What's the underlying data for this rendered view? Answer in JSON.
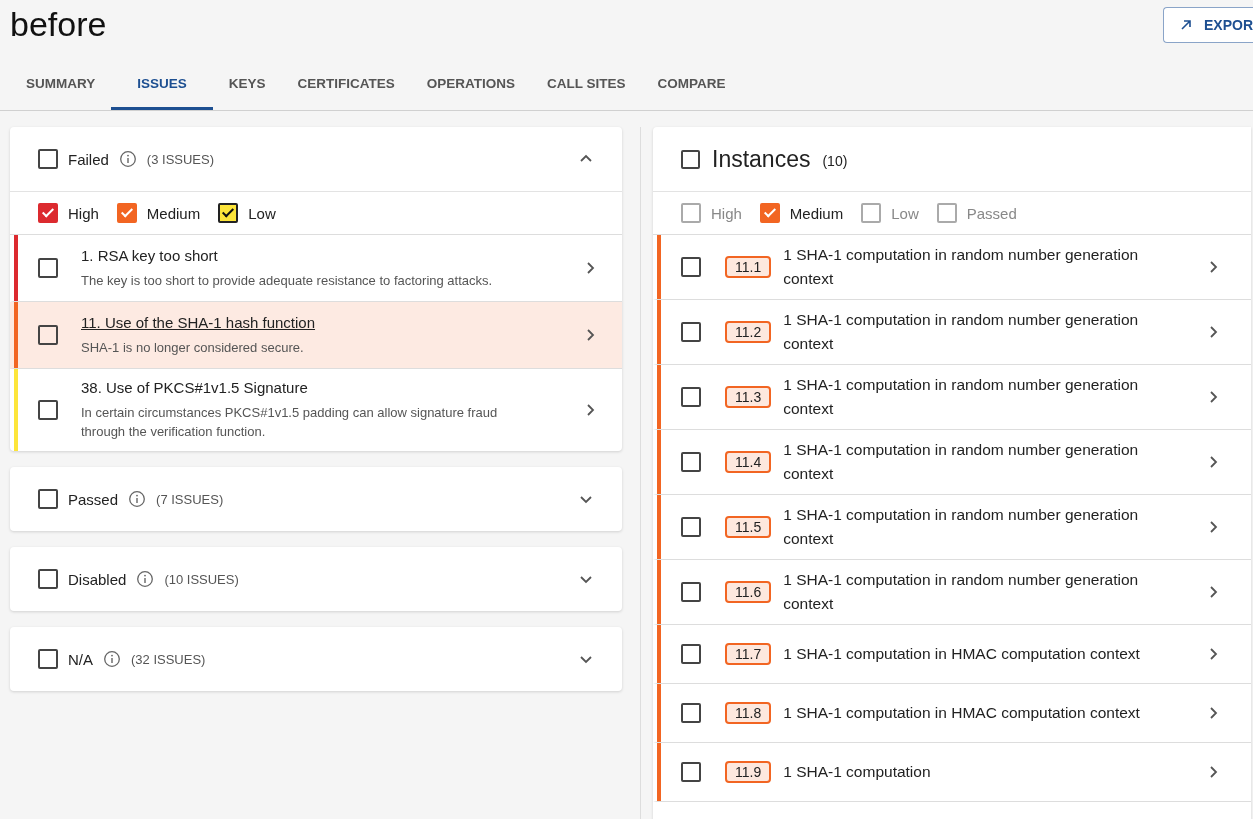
{
  "title": "before",
  "export_button": {
    "label": "EXPOR"
  },
  "tabs": [
    {
      "label": "SUMMARY",
      "selected": false
    },
    {
      "label": "ISSUES",
      "selected": true
    },
    {
      "label": "KEYS",
      "selected": false
    },
    {
      "label": "CERTIFICATES",
      "selected": false
    },
    {
      "label": "OPERATIONS",
      "selected": false
    },
    {
      "label": "CALL SITES",
      "selected": false
    },
    {
      "label": "COMPARE",
      "selected": false
    }
  ],
  "groups": [
    {
      "label": "Failed",
      "count": "(3 ISSUES)",
      "checked": false,
      "expanded": true,
      "filters": [
        {
          "label": "High",
          "checked": true,
          "color": "#dc2a2f"
        },
        {
          "label": "Medium",
          "checked": true,
          "color": "#f26522"
        },
        {
          "label": "Low",
          "checked": true,
          "color": "#fde53a"
        }
      ],
      "issues": [
        {
          "title": "1. RSA key too short",
          "description": "The key is too short to provide adequate resistance to factoring attacks.",
          "checked": false,
          "selected": false,
          "color": "#dc2a2f"
        },
        {
          "title": "11. Use of the SHA-1 hash function",
          "description": "SHA-1 is no longer considered secure.",
          "checked": false,
          "selected": true,
          "color": "#f26522"
        },
        {
          "title": "38. Use of PKCS#1v1.5 Signature",
          "description": "In certain circumstances PKCS#1v1.5 padding can allow signature fraud through the verification function.",
          "checked": false,
          "selected": false,
          "color": "#fde53a"
        }
      ]
    },
    {
      "label": "Passed",
      "count": "(7 ISSUES)",
      "checked": false,
      "expanded": false
    },
    {
      "label": "Disabled",
      "count": "(10 ISSUES)",
      "checked": false,
      "expanded": false
    },
    {
      "label": "N/A",
      "count": "(32 ISSUES)",
      "checked": false,
      "expanded": false
    }
  ],
  "instances": {
    "title": "Instances",
    "count": "(10)",
    "checked": false,
    "filters": [
      {
        "label": "High",
        "checked": false
      },
      {
        "label": "Medium",
        "checked": true,
        "color": "#f26522"
      },
      {
        "label": "Low",
        "checked": false
      },
      {
        "label": "Passed",
        "checked": false
      }
    ],
    "rows": [
      {
        "badge": "11.1",
        "text": "1 SHA-1 computation in random number generation context",
        "checked": false,
        "color": "#f26522"
      },
      {
        "badge": "11.2",
        "text": "1 SHA-1 computation in random number generation context",
        "checked": false,
        "color": "#f26522"
      },
      {
        "badge": "11.3",
        "text": "1 SHA-1 computation in random number generation context",
        "checked": false,
        "color": "#f26522"
      },
      {
        "badge": "11.4",
        "text": "1 SHA-1 computation in random number generation context",
        "checked": false,
        "color": "#f26522"
      },
      {
        "badge": "11.5",
        "text": "1 SHA-1 computation in random number generation context",
        "checked": false,
        "color": "#f26522"
      },
      {
        "badge": "11.6",
        "text": "1 SHA-1 computation in random number generation context",
        "checked": false,
        "color": "#f26522"
      },
      {
        "badge": "11.7",
        "text": "1 SHA-1 computation in HMAC computation context",
        "checked": false,
        "color": "#f26522"
      },
      {
        "badge": "11.8",
        "text": "1 SHA-1 computation in HMAC computation context",
        "checked": false,
        "color": "#f26522"
      },
      {
        "badge": "11.9",
        "text": "1 SHA-1 computation",
        "checked": false,
        "color": "#f26522"
      }
    ]
  }
}
